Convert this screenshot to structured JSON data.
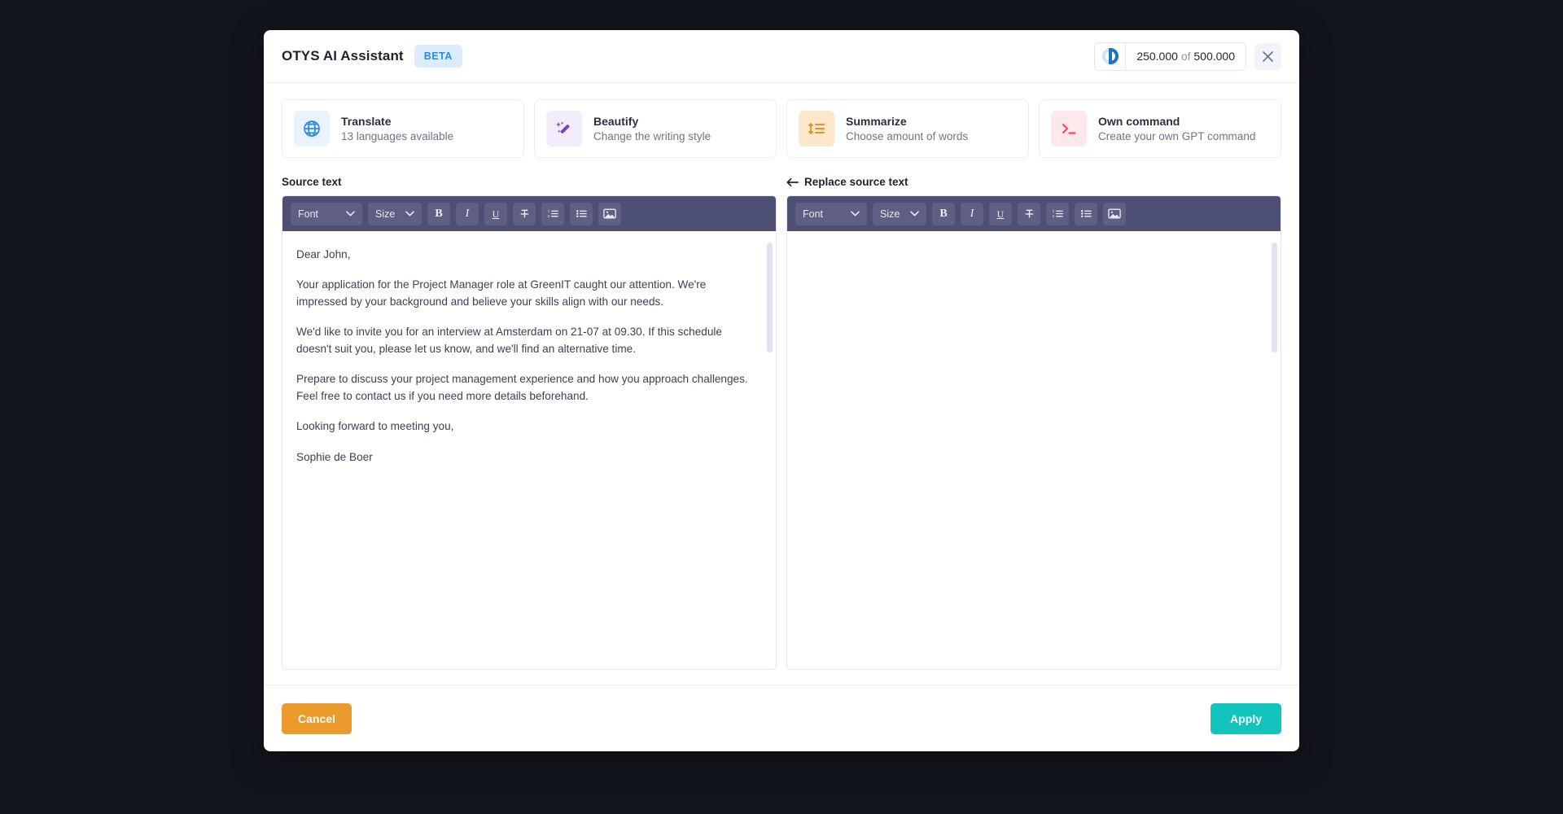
{
  "header": {
    "title": "OTYS AI Assistant",
    "badge": "BETA",
    "tokens_used": "250.000",
    "tokens_of": "of",
    "tokens_total": "500.000",
    "progress_icon": "donut-progress-icon",
    "close_icon": "close-icon"
  },
  "cards": [
    {
      "title": "Translate",
      "subtitle": "13 languages available",
      "icon": "globe-icon",
      "color": "#2c8ae0",
      "bg": "#e9f3fd"
    },
    {
      "title": "Beautify",
      "subtitle": "Change the writing style",
      "icon": "magic-wand-icon",
      "color": "#7e3fc4",
      "bg": "#f2ecfb"
    },
    {
      "title": "Summarize",
      "subtitle": "Choose amount of words",
      "icon": "resize-lines-icon",
      "color": "#e8912c",
      "bg": "#fde7cb"
    },
    {
      "title": "Own command",
      "subtitle": "Create your own GPT command",
      "icon": "terminal-icon",
      "color": "#ef4a64",
      "bg": "#fde9ec"
    }
  ],
  "panes": {
    "source": {
      "label": "Source text",
      "toolbar": {
        "font_label": "Font",
        "size_label": "Size",
        "bold": "B",
        "italic": "I",
        "underline": "U",
        "strikethrough": "S",
        "numbered_list": "numbered-list-icon",
        "bullet_list": "bullet-list-icon",
        "image": "image-icon"
      },
      "paragraphs": [
        "Dear John,",
        "Your application for the Project Manager role at GreenIT caught our attention. We're impressed by your background and believe your skills align with our needs.",
        "We'd like to invite you for an interview at Amsterdam on 21-07 at 09.30. If this schedule doesn't suit you, please let us know, and we'll find an alternative time.",
        "Prepare to discuss your project management experience and how you approach challenges. Feel free to contact us if you need more details beforehand.",
        "Looking forward to meeting you,",
        "Sophie de Boer"
      ]
    },
    "result": {
      "label": "Replace source text",
      "back_icon": "arrow-left-icon",
      "toolbar": {
        "font_label": "Font",
        "size_label": "Size",
        "bold": "B",
        "italic": "I",
        "underline": "U",
        "strikethrough": "S",
        "numbered_list": "numbered-list-icon",
        "bullet_list": "bullet-list-icon",
        "image": "image-icon"
      },
      "content": ""
    }
  },
  "footer": {
    "cancel_label": "Cancel",
    "apply_label": "Apply"
  },
  "colors": {
    "toolbar_bg": "#4e4f74",
    "cancel": "#eb9b2d",
    "apply": "#12c4bd",
    "badge_text": "#2c8ae0",
    "backdrop": "#13151c"
  }
}
